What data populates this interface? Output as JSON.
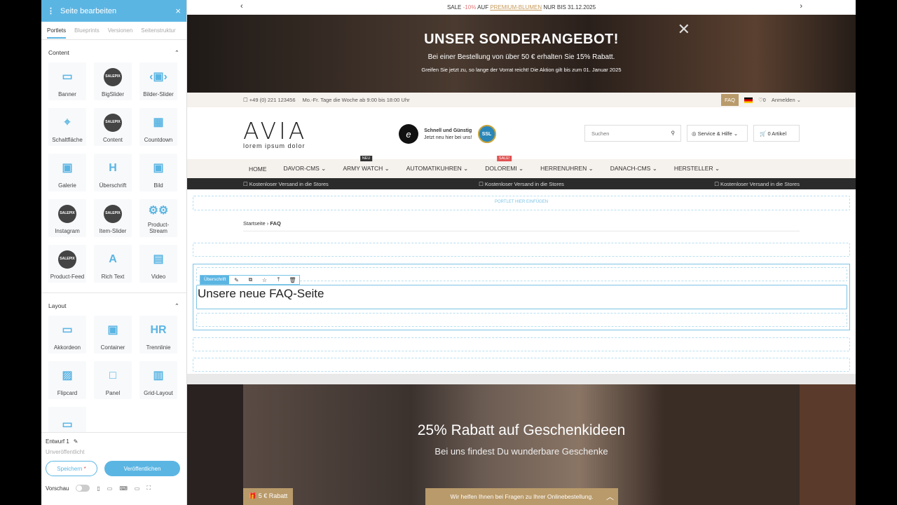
{
  "editor": {
    "title": "Seite bearbeiten",
    "tabs": [
      "Portlets",
      "Blueprints",
      "Versionen",
      "Seitenstruktur"
    ],
    "sections": [
      {
        "title": "Content",
        "items": [
          {
            "label": "Banner",
            "icon": "banner-icon"
          },
          {
            "label": "BigSlider",
            "icon": "salepix-icon"
          },
          {
            "label": "Bilder-Slider",
            "icon": "image-slider-icon"
          },
          {
            "label": "Schaltfläche",
            "icon": "button-icon"
          },
          {
            "label": "Content",
            "icon": "salepix-icon"
          },
          {
            "label": "Countdown",
            "icon": "calendar-icon"
          },
          {
            "label": "Galerie",
            "icon": "gallery-icon"
          },
          {
            "label": "Überschrift",
            "icon": "heading-icon"
          },
          {
            "label": "Bild",
            "icon": "image-icon"
          },
          {
            "label": "Instagram",
            "icon": "salepix-icon"
          },
          {
            "label": "Item-Slider",
            "icon": "salepix-icon"
          },
          {
            "label": "Product-Stream",
            "icon": "product-stream-icon"
          },
          {
            "label": "Product-Feed",
            "icon": "salepix-icon"
          },
          {
            "label": "Rich Text",
            "icon": "richtext-icon"
          },
          {
            "label": "Video",
            "icon": "video-icon"
          }
        ]
      },
      {
        "title": "Layout",
        "items": [
          {
            "label": "Akkordeon",
            "icon": "accordion-icon"
          },
          {
            "label": "Container",
            "icon": "container-icon"
          },
          {
            "label": "Trennlinie",
            "icon": "hr-icon"
          },
          {
            "label": "Flipcard",
            "icon": "flipcard-icon"
          },
          {
            "label": "Panel",
            "icon": "panel-icon"
          },
          {
            "label": "Grid-Layout",
            "icon": "grid-layout-icon"
          },
          {
            "label": "",
            "icon": "folder-icon"
          }
        ]
      }
    ],
    "salepix_text": "SALEPIX",
    "draft": "Entwurf 1",
    "unpublished": "Unveröffentlicht",
    "save": "Speichern",
    "save_marker": "*",
    "publish": "Veröffentlichen",
    "preview": "Vorschau"
  },
  "site": {
    "topbar": {
      "a": "SALE ",
      "b": "-10%",
      "c": " AUF ",
      "d": "PREMIUM-BLUMEN",
      "e": " NUR BIS 31.12.2025"
    },
    "hero": {
      "title": "UNSER SONDERANGEBOT!",
      "line1": "Bei einer Bestellung von über 50 € erhalten Sie 15% Rabatt.",
      "line2": "Greifen Sie jetzt zu, so lange der Vorrat reicht! Die Aktion gilt bis zum 01. Januar 2025"
    },
    "infobar": {
      "phone": "☐ +49 (0) 221 123456",
      "hours": "Mo.-Fr. Tage die Woche ab 9:00 bis 18:00 Uhr",
      "faq": "FAQ",
      "wish": "♡0",
      "login": "Anmelden ⌄"
    },
    "logo": {
      "name": "AVIA",
      "tagline": "lorem ipsum dolor"
    },
    "trust": {
      "line1": "Schnell und Günstig",
      "line2": "Jetzt neu hier bei uns!",
      "ssl": "SSL",
      "t": "e"
    },
    "search_placeholder": "Suchen",
    "service": "Service & Hilfe",
    "cart": "0 Artikel",
    "nav": [
      {
        "label": "HOME",
        "tag": "",
        "tag_color": ""
      },
      {
        "label": "DAVOR-CMS ⌄",
        "tag": "",
        "tag_color": ""
      },
      {
        "label": "ARMY WATCH ⌄",
        "tag": "NEU",
        "tag_color": "#333333"
      },
      {
        "label": "AUTOMATIKUHREN ⌄",
        "tag": "",
        "tag_color": ""
      },
      {
        "label": "DOLOREMI ⌄",
        "tag": "SALE!",
        "tag_color": "#e05252"
      },
      {
        "label": "HERRENUHREN ⌄",
        "tag": "",
        "tag_color": ""
      },
      {
        "label": "DANACH-CMS ⌄",
        "tag": "",
        "tag_color": ""
      },
      {
        "label": "HERSTELLER ⌄",
        "tag": "",
        "tag_color": ""
      }
    ],
    "shipping": [
      "☐ Kostenloser Versand in die Stores",
      "☐ Kostenloser Versand in die Stores",
      "☐ Kostenloser Versand in die Stores"
    ],
    "portlet_insert": "PORTLET HIER EINFÜGEN",
    "breadcrumb": {
      "home": "Startseite",
      "sep": "›",
      "current": "FAQ"
    },
    "toolbar_label": "Überschrift",
    "heading": "Unsere neue FAQ-Seite",
    "banner": {
      "title": "25% Rabatt auf Geschenkideen",
      "subtitle": "Bei uns findest Du wunderbare Geschenke",
      "rabatt": "5 € Rabatt",
      "help": "Wir helfen Ihnen bei Fragen zu Ihrer Onlinebestellung."
    }
  },
  "colors": {
    "accent": "#5bb5e3",
    "gold": "#b99a6a"
  }
}
